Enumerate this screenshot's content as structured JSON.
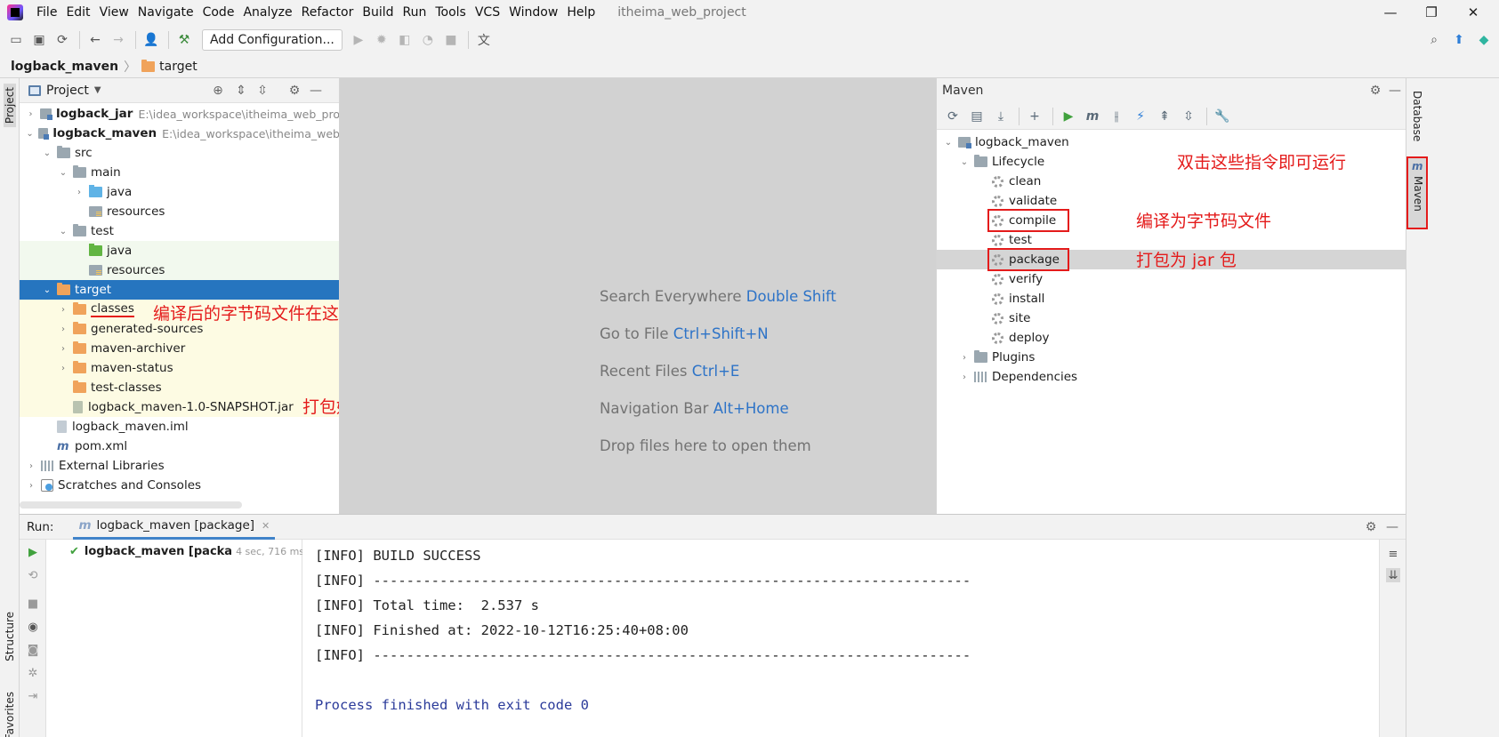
{
  "menubar": {
    "items": [
      "File",
      "Edit",
      "View",
      "Navigate",
      "Code",
      "Analyze",
      "Refactor",
      "Build",
      "Run",
      "Tools",
      "VCS",
      "Window",
      "Help"
    ],
    "project_title": "itheima_web_project",
    "minimize": "—",
    "restore": "❐",
    "close": "✕"
  },
  "toolbar": {
    "add_config_label": "Add Configuration..."
  },
  "breadcrumb": {
    "project": "logback_maven",
    "folder": "target"
  },
  "left_stripe": {
    "project_tab": "Project",
    "structure_tab": "Structure",
    "favorites_tab": "Favorites"
  },
  "project_panel": {
    "title": "Project",
    "tree": [
      {
        "label": "logback_jar",
        "path": "E:\\idea_workspace\\itheima_web_pro",
        "bold": true
      },
      {
        "label": "logback_maven",
        "path": "E:\\idea_workspace\\itheima_web",
        "bold": true
      },
      {
        "label": "src"
      },
      {
        "label": "main"
      },
      {
        "label": "java"
      },
      {
        "label": "resources"
      },
      {
        "label": "test"
      },
      {
        "label": "java"
      },
      {
        "label": "resources"
      },
      {
        "label": "target"
      },
      {
        "label": "classes"
      },
      {
        "label": "generated-sources"
      },
      {
        "label": "maven-archiver"
      },
      {
        "label": "maven-status"
      },
      {
        "label": "test-classes"
      },
      {
        "label": "logback_maven-1.0-SNAPSHOT.jar"
      },
      {
        "label": "logback_maven.iml"
      },
      {
        "label": "pom.xml"
      },
      {
        "label": "External Libraries"
      },
      {
        "label": "Scratches and Consoles"
      }
    ]
  },
  "annotations": {
    "classes_note": "编译后的字节码文件在这个目录下",
    "jar_note": "打包好的 jar 包",
    "double_click_note": "双击这些指令即可运行",
    "compile_note": "编译为字节码文件",
    "package_note": "打包为 jar 包"
  },
  "editor": {
    "hints": [
      {
        "text": "Search Everywhere ",
        "shortcut": "Double Shift"
      },
      {
        "text": "Go to File ",
        "shortcut": "Ctrl+Shift+N"
      },
      {
        "text": "Recent Files ",
        "shortcut": "Ctrl+E"
      },
      {
        "text": "Navigation Bar ",
        "shortcut": "Alt+Home"
      },
      {
        "text": "Drop files here to open them",
        "shortcut": ""
      }
    ]
  },
  "maven_panel": {
    "title": "Maven",
    "root": "logback_maven",
    "lifecycle": "Lifecycle",
    "phases": [
      "clean",
      "validate",
      "compile",
      "test",
      "package",
      "verify",
      "install",
      "site",
      "deploy"
    ],
    "plugins": "Plugins",
    "dependencies": "Dependencies"
  },
  "right_stripe": {
    "database_tab": "Database",
    "maven_tab": "Maven"
  },
  "run_panel": {
    "label": "Run:",
    "tab_label": "logback_maven [package]",
    "tree_item": "logback_maven [packa",
    "tree_time": "4 sec, 716 ms",
    "console": [
      "[INFO] BUILD SUCCESS",
      "[INFO] ------------------------------------------------------------------------",
      "[INFO] Total time:  2.537 s",
      "[INFO] Finished at: 2022-10-12T16:25:40+08:00",
      "[INFO] ------------------------------------------------------------------------",
      "",
      "Process finished with exit code 0"
    ]
  },
  "colors": {
    "selection": "#2675bf",
    "annotation_red": "#e41b1b",
    "shortcut_blue": "#2d73c7"
  }
}
